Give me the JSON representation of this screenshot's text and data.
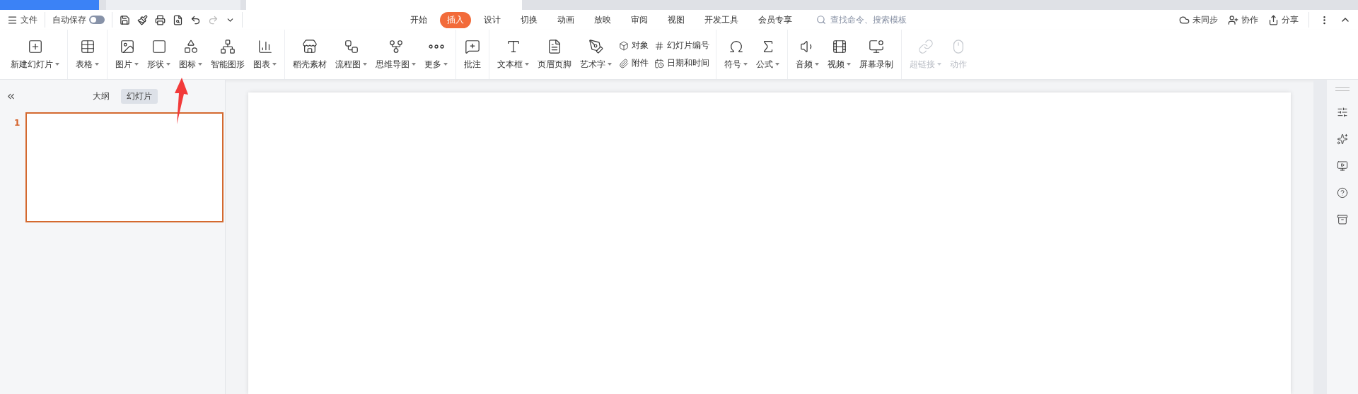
{
  "menu_bar": {
    "file_label": "文件",
    "autosave": {
      "label": "自动保存",
      "on": false
    },
    "tabs": [
      {
        "label": "开始",
        "selected": false
      },
      {
        "label": "插入",
        "selected": true
      },
      {
        "label": "设计",
        "selected": false
      },
      {
        "label": "切换",
        "selected": false
      },
      {
        "label": "动画",
        "selected": false
      },
      {
        "label": "放映",
        "selected": false
      },
      {
        "label": "审阅",
        "selected": false
      },
      {
        "label": "视图",
        "selected": false
      },
      {
        "label": "开发工具",
        "selected": false
      },
      {
        "label": "会员专享",
        "selected": false
      }
    ],
    "search": {
      "placeholder": "查找命令、搜索模板"
    },
    "actions": [
      "未同步",
      "协作",
      "分享"
    ]
  },
  "ribbon": {
    "groups": [
      [
        {
          "kind": "large",
          "label": "新建幻灯片",
          "dropdown": true,
          "disabled": false
        }
      ],
      [
        {
          "kind": "large",
          "label": "表格",
          "dropdown": true,
          "disabled": false
        }
      ],
      [
        {
          "kind": "large",
          "label": "图片",
          "dropdown": true,
          "disabled": false
        },
        {
          "kind": "large",
          "label": "形状",
          "dropdown": true,
          "disabled": false
        },
        {
          "kind": "large",
          "label": "图标",
          "dropdown": true,
          "disabled": false
        },
        {
          "kind": "large",
          "label": "智能图形",
          "dropdown": false,
          "disabled": false
        },
        {
          "kind": "large",
          "label": "图表",
          "dropdown": true,
          "disabled": false
        }
      ],
      [
        {
          "kind": "large",
          "label": "稻壳素材",
          "dropdown": false,
          "disabled": false
        },
        {
          "kind": "large",
          "label": "流程图",
          "dropdown": true,
          "disabled": false
        },
        {
          "kind": "large",
          "label": "思维导图",
          "dropdown": true,
          "disabled": false
        },
        {
          "kind": "large",
          "label": "更多",
          "dropdown": true,
          "disabled": false
        }
      ],
      [
        {
          "kind": "large",
          "label": "批注",
          "dropdown": false,
          "disabled": false
        }
      ],
      [
        {
          "kind": "large",
          "label": "文本框",
          "dropdown": true,
          "disabled": false
        },
        {
          "kind": "large",
          "label": "页眉页脚",
          "dropdown": false,
          "disabled": false
        },
        {
          "kind": "large",
          "label": "艺术字",
          "dropdown": true,
          "disabled": false
        },
        {
          "kind": "pair",
          "items": [
            "对象",
            "附件"
          ]
        },
        {
          "kind": "pair",
          "items": [
            "幻灯片编号",
            "日期和时间"
          ]
        }
      ],
      [
        {
          "kind": "large",
          "label": "符号",
          "dropdown": true,
          "disabled": false
        },
        {
          "kind": "large",
          "label": "公式",
          "dropdown": true,
          "disabled": false
        }
      ],
      [
        {
          "kind": "large",
          "label": "音频",
          "dropdown": true,
          "disabled": false
        },
        {
          "kind": "large",
          "label": "视频",
          "dropdown": true,
          "disabled": false
        },
        {
          "kind": "large",
          "label": "屏幕录制",
          "dropdown": false,
          "disabled": false
        }
      ],
      [
        {
          "kind": "large",
          "label": "超链接",
          "dropdown": true,
          "disabled": true
        },
        {
          "kind": "large",
          "label": "动作",
          "dropdown": false,
          "disabled": true
        }
      ]
    ]
  },
  "slide_panel": {
    "tabs": [
      {
        "label": "大纲",
        "selected": false
      },
      {
        "label": "幻灯片",
        "selected": true
      }
    ],
    "slides": [
      {
        "number": "1",
        "selected": true
      }
    ]
  }
}
